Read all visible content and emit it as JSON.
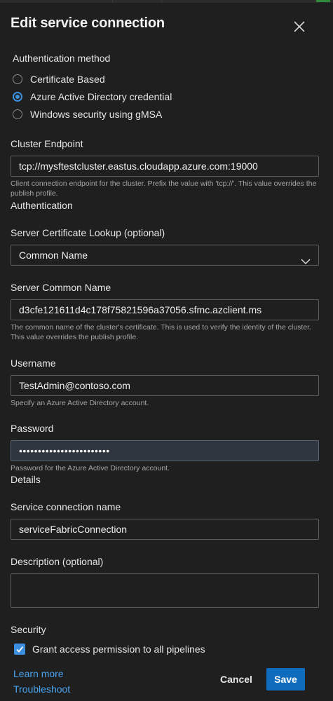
{
  "dialog": {
    "title": "Edit service connection"
  },
  "auth_method": {
    "label": "Authentication method",
    "options": [
      {
        "label": "Certificate Based",
        "checked": false
      },
      {
        "label": "Azure Active Directory credential",
        "checked": true
      },
      {
        "label": "Windows security using gMSA",
        "checked": false
      }
    ]
  },
  "cluster_endpoint": {
    "label": "Cluster Endpoint",
    "value": "tcp://mysftestcluster.eastus.cloudapp.azure.com:19000",
    "help": "Client connection endpoint for the cluster. Prefix the value with 'tcp://'. This value overrides the publish profile."
  },
  "authentication_section": "Authentication",
  "cert_lookup": {
    "label": "Server Certificate Lookup (optional)",
    "value": "Common Name"
  },
  "common_name": {
    "label": "Server Common Name",
    "value": "d3cfe121611d4c178f75821596a37056.sfmc.azclient.ms",
    "help": "The common name of the cluster's certificate. This is used to verify the identity of the cluster. This value overrides the publish profile."
  },
  "username": {
    "label": "Username",
    "value": "TestAdmin@contoso.com",
    "help": "Specify an Azure Active Directory account."
  },
  "password": {
    "label": "Password",
    "value": "••••••••••••••••••••••••",
    "help": "Password for the Azure Active Directory account."
  },
  "details_section": "Details",
  "connection_name": {
    "label": "Service connection name",
    "value": "serviceFabricConnection"
  },
  "description": {
    "label": "Description (optional)",
    "value": ""
  },
  "security": {
    "label": "Security",
    "grant_label": "Grant access permission to all pipelines",
    "grant_checked": true
  },
  "links": {
    "learn_more": "Learn more",
    "troubleshoot": "Troubleshoot"
  },
  "buttons": {
    "cancel": "Cancel",
    "save": "Save"
  },
  "colors": {
    "accent": "#3b8fde",
    "primary_button": "#0f6cbd",
    "link": "#4aa3ee"
  }
}
